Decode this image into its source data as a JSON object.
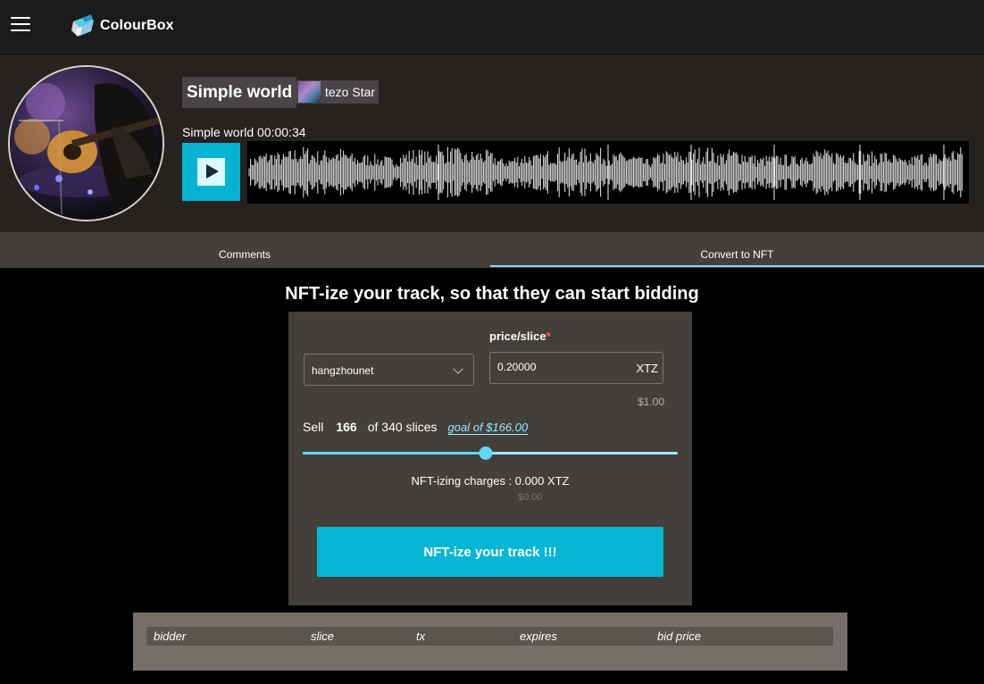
{
  "app": {
    "name": "ColourBox"
  },
  "player": {
    "title": "Simple world",
    "artist": "tezo Star",
    "time_text": "Simple world 00:00:34"
  },
  "tabs": [
    {
      "label": "Comments",
      "active": false
    },
    {
      "label": "Convert to NFT",
      "active": true
    }
  ],
  "nft": {
    "heading": "NFT-ize your track, so that they can start bidding",
    "network_selected": "hangzhounet",
    "price_label": "price/slice",
    "price_required_mark": "*",
    "price_value": "0.20000",
    "price_currency": "XTZ",
    "price_usd": "$1.00",
    "sell_prefix": "Sell",
    "sell_count": "166",
    "sell_total_text": "of 340 slices",
    "goal_text": "goal of $166.00",
    "slider_fraction": 0.488,
    "charges_text": "NFT-izing charges : 0.000 XTZ",
    "charges_usd": "$0.00",
    "button_label": "NFT-ize your track !!!"
  },
  "bids": {
    "columns": [
      "bidder",
      "slice",
      "tx",
      "expires",
      "bid price"
    ],
    "rows": []
  },
  "colors": {
    "accent": "#07b6d4",
    "slider": "#61d6f5",
    "card": "#433f3a",
    "required": "#ff5a5a"
  }
}
